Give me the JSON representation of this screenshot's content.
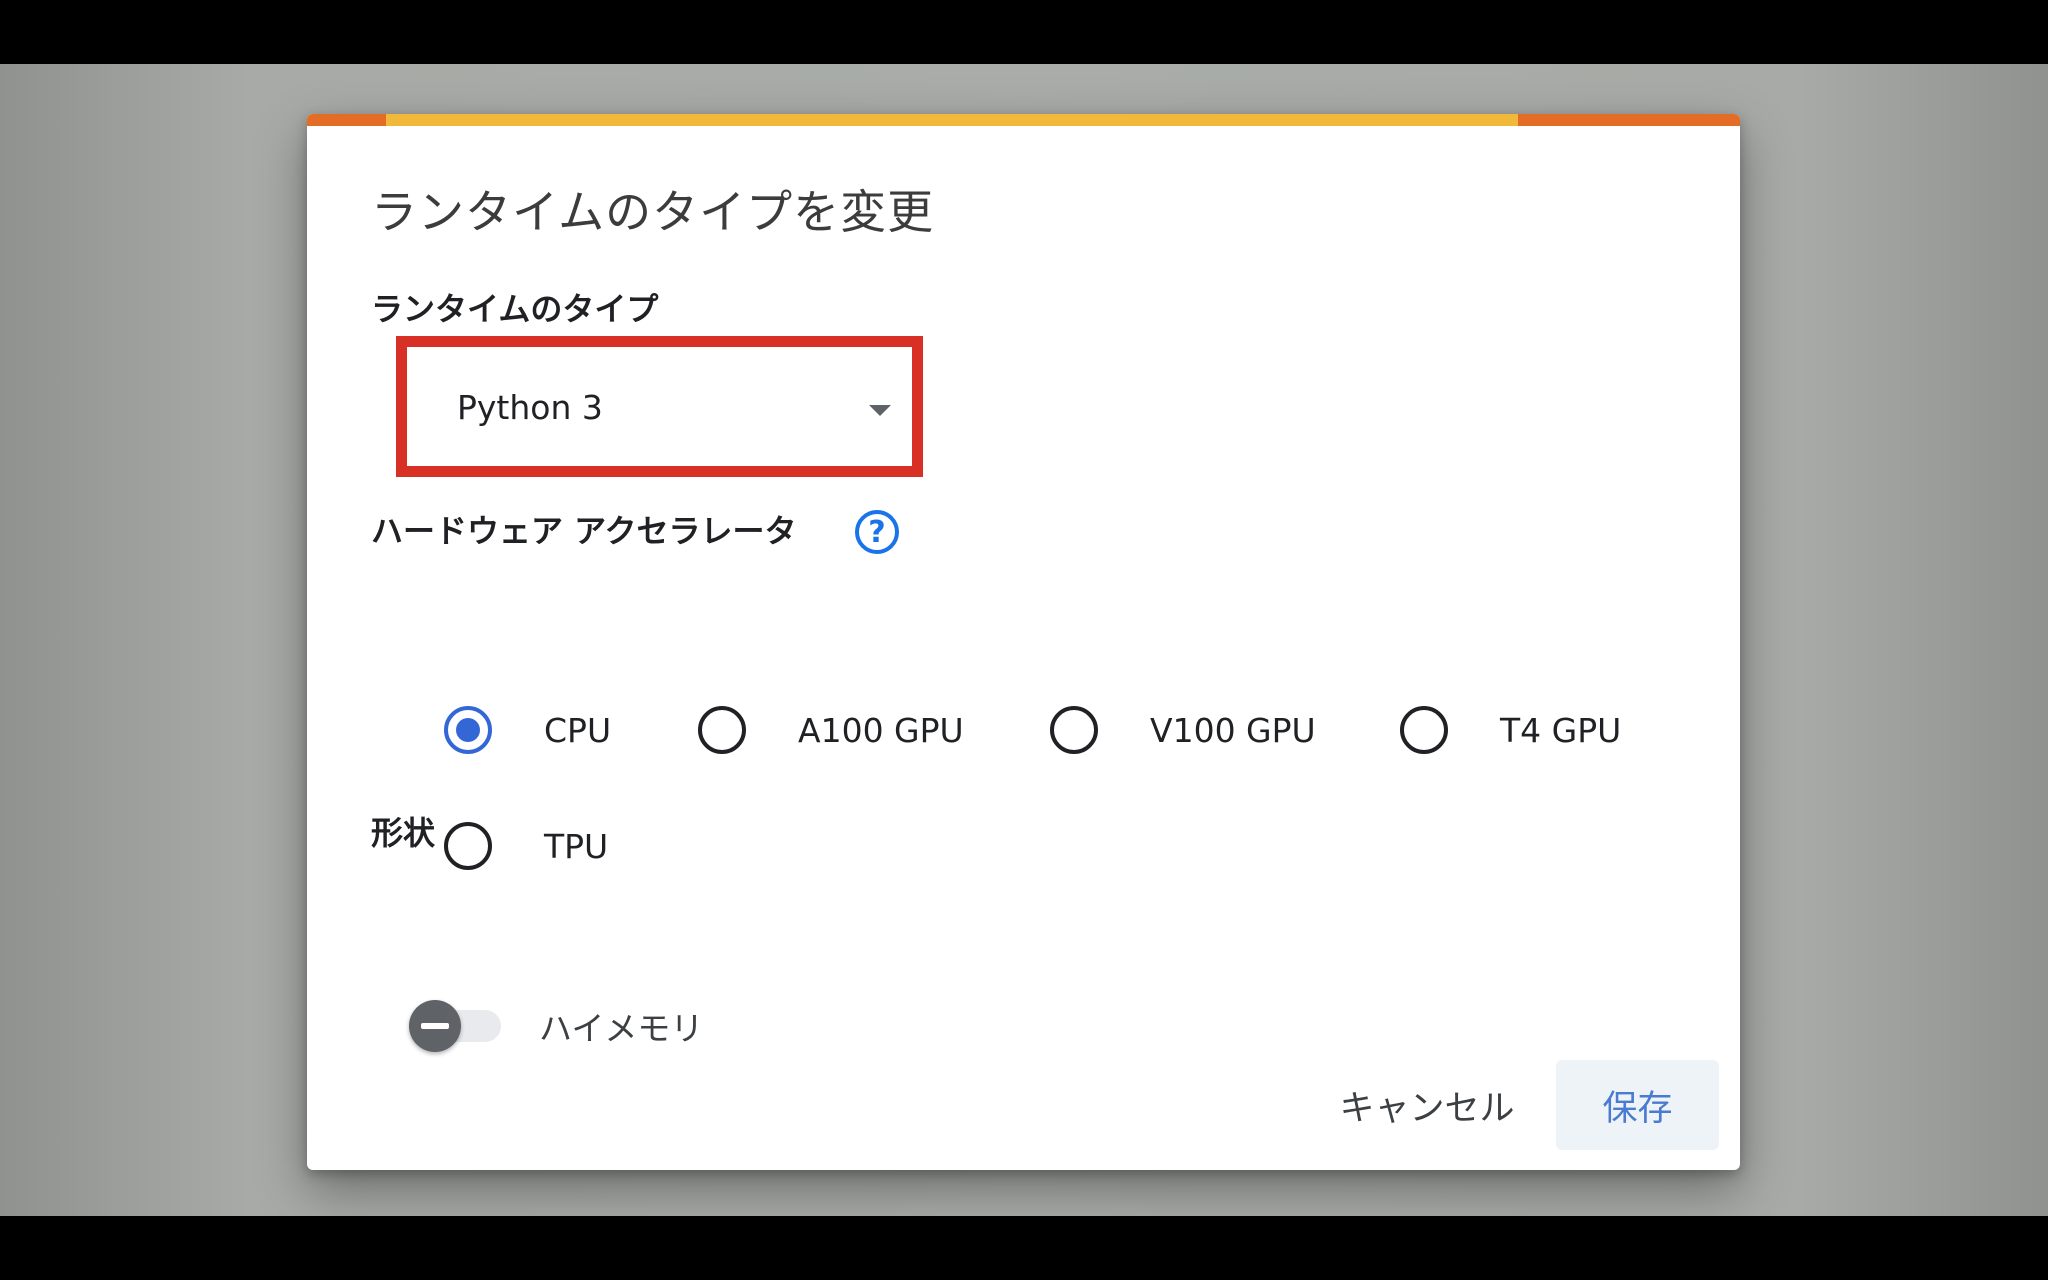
{
  "dialog": {
    "title": "ランタイムのタイプを変更",
    "accent_colors": [
      "#e36d24",
      "#f2b83a"
    ]
  },
  "runtime_type": {
    "label": "ランタイムのタイプ",
    "selected_value": "Python 3",
    "highlight_color": "#d93025"
  },
  "hardware_accelerator": {
    "label": "ハードウェア アクセラレータ",
    "help_icon": "question-circle-icon",
    "help_glyph": "?",
    "options": [
      {
        "label": "CPU",
        "checked": true
      },
      {
        "label": "A100 GPU",
        "checked": false
      },
      {
        "label": "V100 GPU",
        "checked": false
      },
      {
        "label": "T4 GPU",
        "checked": false
      },
      {
        "label": "TPU",
        "checked": false
      }
    ]
  },
  "shape": {
    "label": "形状",
    "high_memory_label": "ハイメモリ",
    "high_memory_enabled": false
  },
  "actions": {
    "cancel_label": "キャンセル",
    "save_label": "保存"
  }
}
